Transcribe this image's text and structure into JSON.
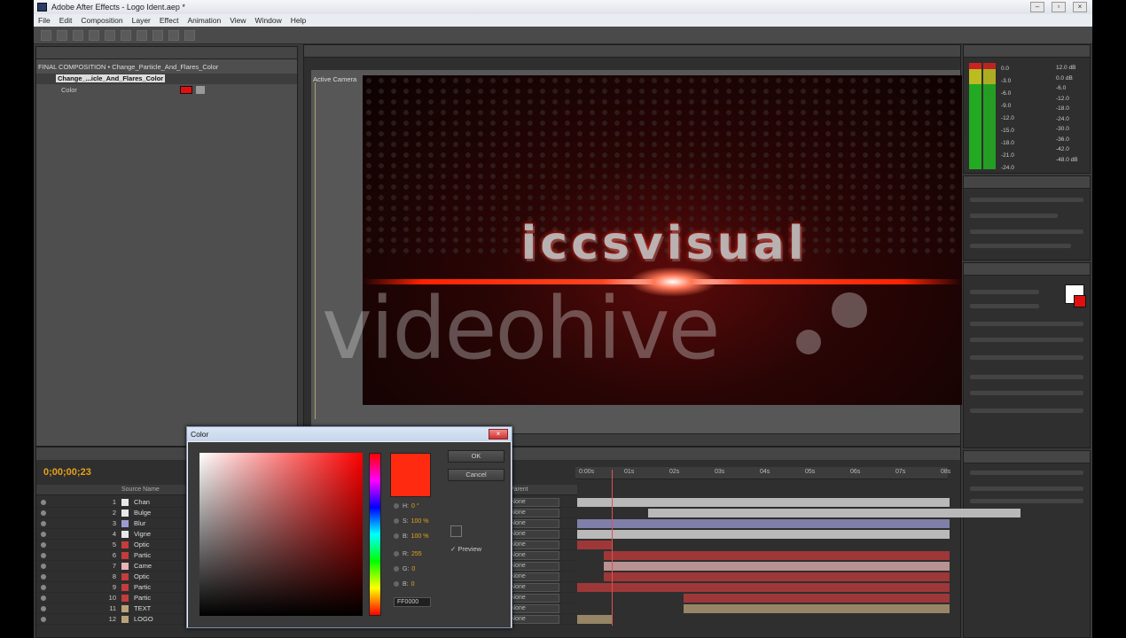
{
  "app": {
    "title": "Adobe After Effects - Logo Ident.aep *",
    "window_buttons": [
      "–",
      "▫",
      "×"
    ]
  },
  "menu": [
    "File",
    "Edit",
    "Composition",
    "Layer",
    "Effect",
    "Animation",
    "View",
    "Window",
    "Help"
  ],
  "project": {
    "breadcrumb": "FINAL COMPOSITION • Change_Particle_And_Flares_Color",
    "effect_name": "Change_...icle_And_Flares_Color",
    "effect_prop": "Color"
  },
  "comp": {
    "view_label": "Active Camera",
    "logo_text": "iccsvisual",
    "watermark": "videohive"
  },
  "timeline": {
    "timecode": "0;00;00;23",
    "col_source": "Source Name",
    "col_parent": "Parent",
    "layers": [
      {
        "num": "1",
        "name": "Chan",
        "color": "#e8e8e8",
        "parent": "None"
      },
      {
        "num": "2",
        "name": "Bulge",
        "color": "#e8e8e8",
        "parent": "None"
      },
      {
        "num": "3",
        "name": "Blur",
        "color": "#9b9bd4",
        "parent": "None"
      },
      {
        "num": "4",
        "name": "Vigne",
        "color": "#e8e8e8",
        "parent": "None"
      },
      {
        "num": "5",
        "name": "Optic",
        "color": "#c43c3c",
        "parent": "None"
      },
      {
        "num": "6",
        "name": "Partic",
        "color": "#c43c3c",
        "parent": "None"
      },
      {
        "num": "7",
        "name": "Came",
        "color": "#e8b4b4",
        "parent": "None"
      },
      {
        "num": "8",
        "name": "Optic",
        "color": "#c43c3c",
        "parent": "None"
      },
      {
        "num": "9",
        "name": "Partic",
        "color": "#c43c3c",
        "parent": "None"
      },
      {
        "num": "10",
        "name": "Partic",
        "color": "#c43c3c",
        "parent": "None"
      },
      {
        "num": "11",
        "name": "TEXT",
        "color": "#b9a37a",
        "parent": "None"
      },
      {
        "num": "12",
        "name": "LOGO",
        "color": "#b9a37a",
        "parent": "None"
      }
    ],
    "ruler": [
      "0:00s",
      "01s",
      "02s",
      "03s",
      "04s",
      "05s",
      "06s",
      "07s",
      "08s"
    ]
  },
  "color_dialog": {
    "title": "Color",
    "ok": "OK",
    "cancel": "Cancel",
    "preview": "Preview",
    "h_label": "H:",
    "h_value": "0 °",
    "s_label": "S:",
    "s_value": "100 %",
    "b_label": "B:",
    "b_value": "100 %",
    "r_label": "R:",
    "r_value": "255",
    "g_label": "G:",
    "g_value": "0",
    "bl_label": "B:",
    "bl_value": "0",
    "hex": "FF0000",
    "selected_color": "#ff2a10"
  },
  "info_panel": {
    "levels": [
      "0.0",
      "-3.0",
      "-6.0",
      "-9.0",
      "-12.0",
      "-15.0",
      "-18.0",
      "-21.0",
      "-24.0"
    ],
    "db": [
      "12.0 dB",
      "0.0 dB",
      "-6.0",
      "-12.0",
      "-18.0",
      "-24.0",
      "-30.0",
      "-36.0",
      "-42.0",
      "-48.0 dB"
    ]
  }
}
